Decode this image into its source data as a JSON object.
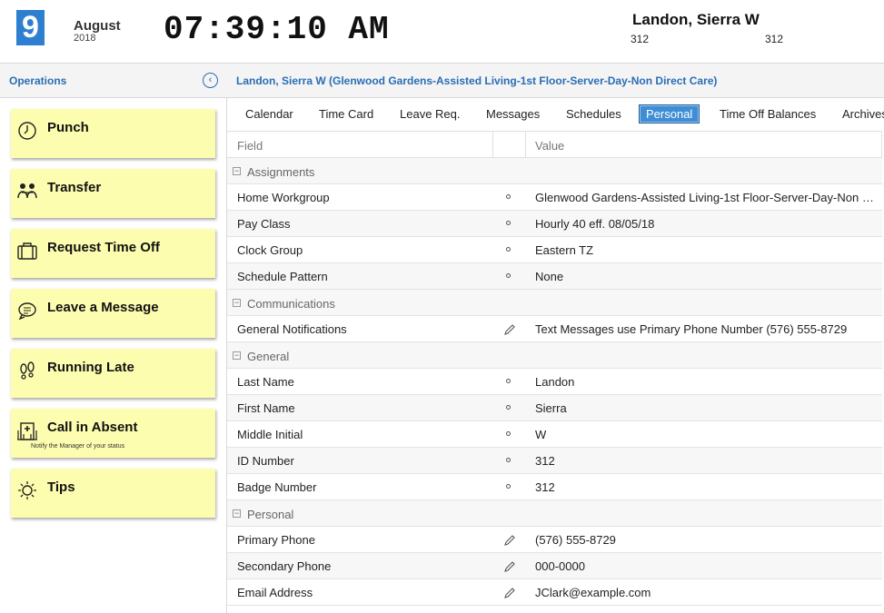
{
  "header": {
    "day": "9",
    "month": "August",
    "year": "2018",
    "time": "07:39:10 AM",
    "employee_name": "Landon, Sierra W",
    "employee_id_left": "312",
    "employee_id_right": "312"
  },
  "subbar": {
    "section_label": "Operations",
    "collapse_icon": "chevron-left-icon",
    "breadcrumb": "Landon, Sierra W (Glenwood Gardens-Assisted Living-1st Floor-Server-Day-Non Direct Care)"
  },
  "sidebar": {
    "items": [
      {
        "label": "Punch",
        "icon": "clock-icon"
      },
      {
        "label": "Transfer",
        "icon": "transfer-people-icon"
      },
      {
        "label": "Request Time Off",
        "icon": "suitcase-icon"
      },
      {
        "label": "Leave a Message",
        "icon": "speech-bubble-icon"
      },
      {
        "label": "Running Late",
        "icon": "footprints-icon"
      },
      {
        "label": "Call in Absent",
        "icon": "hospital-icon",
        "sub": "Notify the Manager of your status"
      },
      {
        "label": "Tips",
        "icon": "sun-icon"
      }
    ]
  },
  "tabs": [
    {
      "label": "Calendar"
    },
    {
      "label": "Time Card"
    },
    {
      "label": "Leave Req."
    },
    {
      "label": "Messages"
    },
    {
      "label": "Schedules"
    },
    {
      "label": "Personal",
      "active": true
    },
    {
      "label": "Time Off Balances"
    },
    {
      "label": "Archives"
    }
  ],
  "grid": {
    "col_field": "Field",
    "col_value": "Value",
    "groups": [
      {
        "name": "Assignments",
        "rows": [
          {
            "field": "Home Workgroup",
            "value": "Glenwood Gardens-Assisted Living-1st Floor-Server-Day-Non Direct Care",
            "editable": false
          },
          {
            "field": "Pay Class",
            "value": "Hourly 40 eff. 08/05/18",
            "editable": false
          },
          {
            "field": "Clock Group",
            "value": "Eastern TZ",
            "editable": false
          },
          {
            "field": "Schedule Pattern",
            "value": "None",
            "editable": false
          }
        ]
      },
      {
        "name": "Communications",
        "rows": [
          {
            "field": "General Notifications",
            "value": "Text Messages use Primary Phone Number (576) 555-8729",
            "editable": true
          }
        ]
      },
      {
        "name": "General",
        "rows": [
          {
            "field": "Last Name",
            "value": "Landon",
            "editable": false
          },
          {
            "field": "First Name",
            "value": "Sierra",
            "editable": false
          },
          {
            "field": "Middle Initial",
            "value": "W",
            "editable": false
          },
          {
            "field": "ID Number",
            "value": "312",
            "editable": false
          },
          {
            "field": "Badge Number",
            "value": "312",
            "editable": false
          }
        ]
      },
      {
        "name": "Personal",
        "rows": [
          {
            "field": "Primary Phone",
            "value": "(576) 555-8729",
            "editable": true
          },
          {
            "field": "Secondary Phone",
            "value": "000-0000",
            "editable": true
          },
          {
            "field": "Email Address",
            "value": "JClark@example.com",
            "editable": true
          }
        ]
      }
    ]
  },
  "colors": {
    "accent": "#2e7fd0",
    "link": "#2a6db5",
    "note_yellow": "#fdfdb0",
    "active_tab": "#3f8dd5"
  }
}
